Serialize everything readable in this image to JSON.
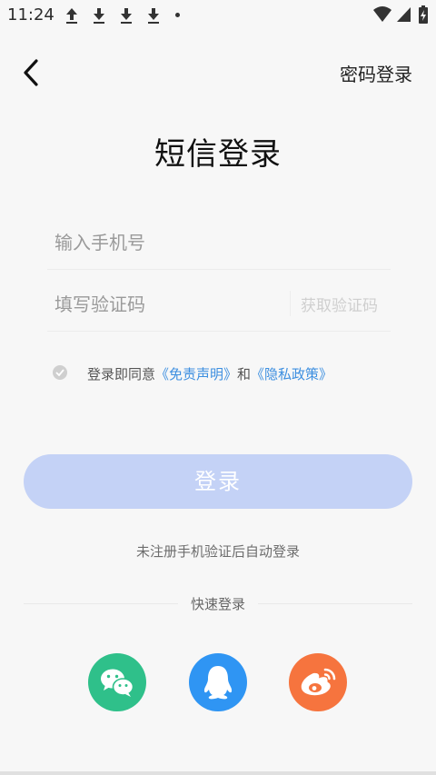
{
  "status_bar": {
    "time": "11:24"
  },
  "header": {
    "password_login": "密码登录"
  },
  "title": "短信登录",
  "phone": {
    "placeholder": "输入手机号"
  },
  "code": {
    "placeholder": "填写验证码",
    "get_code": "获取验证码"
  },
  "agreement": {
    "prefix": "登录即同意",
    "link1": "《免责声明》",
    "middle": "和",
    "link2": "《隐私政策》"
  },
  "login_button": "登录",
  "hint": "未注册手机验证后自动登录",
  "quick_login": {
    "label": "快速登录",
    "options": [
      "wechat",
      "qq",
      "weibo"
    ]
  },
  "colors": {
    "link": "#3d8fe0",
    "login_button": "#c4d2f6",
    "wechat": "#2fc08a",
    "qq": "#2f95f3",
    "weibo": "#f6743e"
  }
}
